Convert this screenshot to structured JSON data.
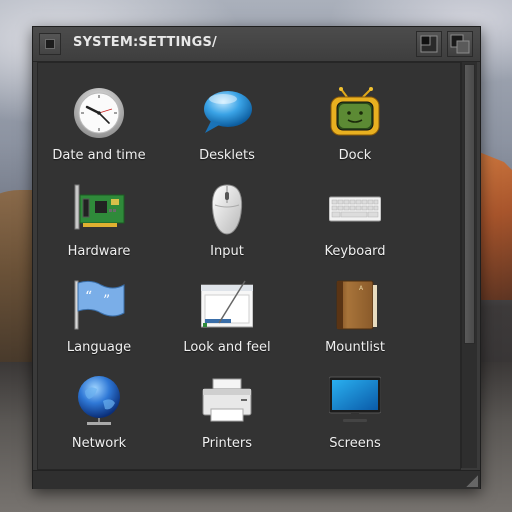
{
  "window": {
    "title": "SYSTEM:SETTINGS/"
  },
  "icons": [
    {
      "label": "Date and time",
      "icon": "clock-icon"
    },
    {
      "label": "Desklets",
      "icon": "speech-bubble-icon"
    },
    {
      "label": "Dock",
      "icon": "tv-icon"
    },
    {
      "label": "Hardware",
      "icon": "pci-card-icon"
    },
    {
      "label": "Input",
      "icon": "mouse-icon"
    },
    {
      "label": "Keyboard",
      "icon": "keyboard-icon"
    },
    {
      "label": "Language",
      "icon": "flag-icon"
    },
    {
      "label": "Look and feel",
      "icon": "window-brush-icon"
    },
    {
      "label": "Mountlist",
      "icon": "book-icon"
    },
    {
      "label": "Network",
      "icon": "globe-icon"
    },
    {
      "label": "Printers",
      "icon": "printer-icon"
    },
    {
      "label": "Screens",
      "icon": "monitor-icon"
    }
  ],
  "colors": {
    "window_bg": "#333333",
    "titlebar": "#444444",
    "label_text": "#f0f0f0"
  }
}
